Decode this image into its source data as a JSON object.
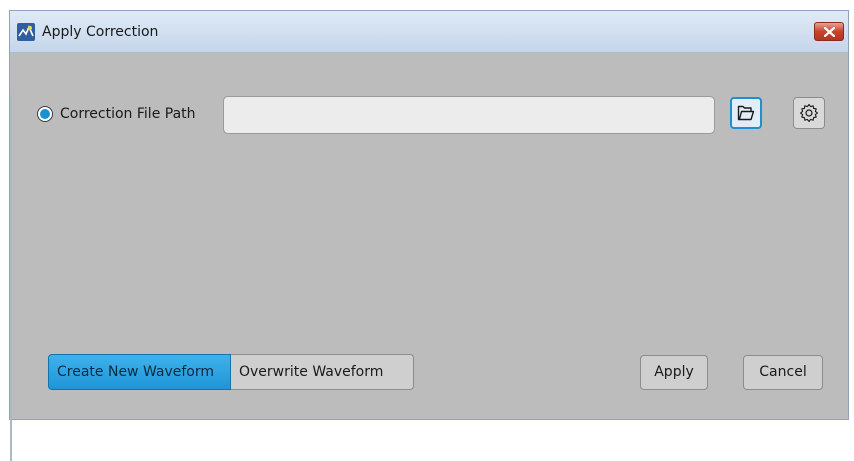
{
  "window": {
    "title": "Apply Correction",
    "icons": {
      "app": "app-icon",
      "close": "close-icon"
    },
    "colors": {
      "accent": "#1f95d8",
      "close": "#c8432c",
      "background": "#bcbcbc"
    }
  },
  "correction": {
    "radio_label": "Correction File Path",
    "radio_selected": true,
    "path_value": "",
    "path_placeholder": "",
    "browse_icon": "folder-open-icon",
    "settings_icon": "gear-icon"
  },
  "mode": {
    "options": [
      "Create New Waveform",
      "Overwrite Waveform"
    ],
    "selected": "Create New Waveform"
  },
  "actions": {
    "apply_label": "Apply",
    "cancel_label": "Cancel"
  }
}
